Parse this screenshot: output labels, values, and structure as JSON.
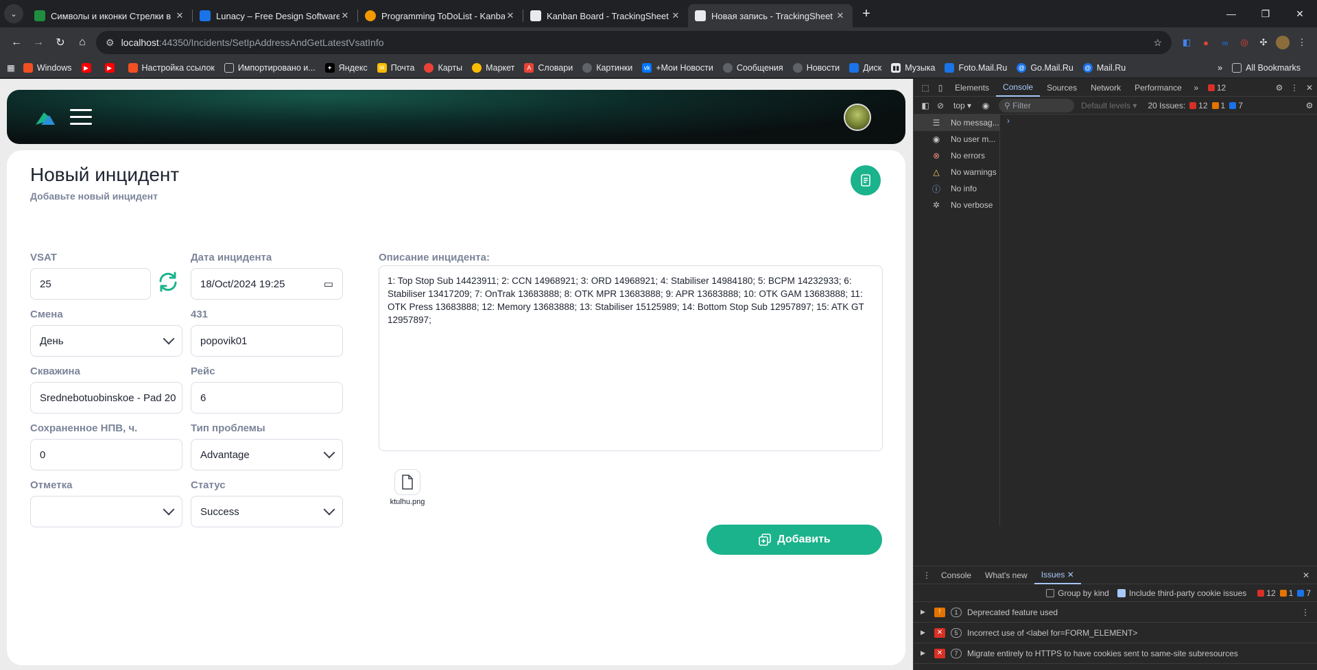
{
  "browser": {
    "tabs": [
      {
        "title": "Символы и иконки Стрелки в",
        "color": "#1e8e3e"
      },
      {
        "title": "Lunacy – Free Design Software",
        "color": "#1a73e8"
      },
      {
        "title": "Programming ToDoList - Kanba",
        "color": "#f29900"
      },
      {
        "title": "Kanban Board - TrackingSheet",
        "color": "#e8eaed"
      },
      {
        "title": "Новая запись - TrackingSheet",
        "color": "#e8eaed"
      }
    ],
    "url_host": "localhost",
    "url_path": ":44350/Incidents/SetIpAddressAndGetLatestVsatInfo",
    "bookmarks": [
      {
        "label": "Windows",
        "color": "#f25022"
      },
      {
        "label": "",
        "color": "#ff0000"
      },
      {
        "label": "",
        "color": "#ff0000"
      },
      {
        "label": "Настройка ссылок",
        "color": "#f25022"
      },
      {
        "label": "Импортировано и...",
        "color": "#5f6368"
      },
      {
        "label": "Яндекс",
        "color": "#202124"
      },
      {
        "label": "Почта",
        "color": "#fbbc04"
      },
      {
        "label": "Карты",
        "color": "#ea4335"
      },
      {
        "label": "Маркет",
        "color": "#fbbc04"
      },
      {
        "label": "Словари",
        "color": "#ea4335"
      },
      {
        "label": "Картинки",
        "color": "#5f6368"
      },
      {
        "label": "+Мои Новости",
        "color": "#0077ff"
      },
      {
        "label": "Сообщения",
        "color": "#5f6368"
      },
      {
        "label": "Новости",
        "color": "#5f6368"
      },
      {
        "label": "Диск",
        "color": "#1a73e8"
      },
      {
        "label": "Музыка",
        "color": "#e8eaed"
      },
      {
        "label": "Foto.Mail.Ru",
        "color": "#1a73e8"
      },
      {
        "label": "Go.Mail.Ru",
        "color": "#1a73e8"
      },
      {
        "label": "Mail.Ru",
        "color": "#1a73e8"
      }
    ],
    "all_bookmarks": "All Bookmarks"
  },
  "page": {
    "title": "Новый инцидент",
    "subtitle": "Добавьте новый инцидент",
    "accent": "#1bb38b",
    "fields": {
      "vsat": {
        "label": "VSAT",
        "value": "25"
      },
      "date": {
        "label": "Дата инцидента",
        "value": "18/Oct/2024 19:25"
      },
      "shift": {
        "label": "Смена",
        "value": "День"
      },
      "f431": {
        "label": "431",
        "value": "popovik01"
      },
      "well": {
        "label": "Скважина",
        "value": "Srednebotuobinskoe - Pad 20"
      },
      "trip": {
        "label": "Рейс",
        "value": "6"
      },
      "npv": {
        "label": "Сохраненное НПВ, ч.",
        "value": "0"
      },
      "problem": {
        "label": "Тип проблемы",
        "value": "Advantage"
      },
      "mark": {
        "label": "Отметка",
        "value": ""
      },
      "status": {
        "label": "Статус",
        "value": "Success"
      },
      "description": {
        "label": "Описание инцидента:",
        "value": "1: Top Stop Sub 14423911; 2: CCN 14968921; 3: ORD 14968921; 4: Stabiliser 14984180; 5: BCPM 14232933; 6: Stabiliser 13417209; 7: OnTrak 13683888; 8: OTK MPR 13683888; 9: APR 13683888; 10: OTK GAM 13683888; 11: OTK Press 13683888; 12: Memory 13683888; 13: Stabiliser 15125989; 14: Bottom Stop Sub 12957897; 15: ATK GT 12957897;"
      }
    },
    "attachment": "ktulhu.png",
    "add_button": "Добавить"
  },
  "devtools": {
    "tabs": [
      "Elements",
      "Console",
      "Sources",
      "Network",
      "Performance"
    ],
    "error_count": "12",
    "context": "top",
    "filter_placeholder": "Filter",
    "levels": "Default levels",
    "issues_summary": "20 Issues:",
    "issue_counts": {
      "errors": "12",
      "warnings": "1",
      "info": "7"
    },
    "sidebar": [
      {
        "icon": "☰",
        "label": "No messag..."
      },
      {
        "icon": "◉",
        "label": "No user m..."
      },
      {
        "icon": "⊗",
        "label": "No errors"
      },
      {
        "icon": "△",
        "label": "No warnings"
      },
      {
        "icon": "ⓘ",
        "label": "No info"
      },
      {
        "icon": "✲",
        "label": "No verbose"
      }
    ],
    "drawer_tabs": [
      "Console",
      "What's new",
      "Issues"
    ],
    "group_by_kind": "Group by kind",
    "include_third_party": "Include third-party cookie issues",
    "issues": [
      {
        "count": "1",
        "text": "Deprecated feature used",
        "sev": "#e37400"
      },
      {
        "count": "5",
        "text": "Incorrect use of <label for=FORM_ELEMENT>",
        "sev": "#d93025"
      },
      {
        "count": "7",
        "text": "Migrate entirely to HTTPS to have cookies sent to same-site subresources",
        "sev": "#d93025"
      }
    ]
  }
}
